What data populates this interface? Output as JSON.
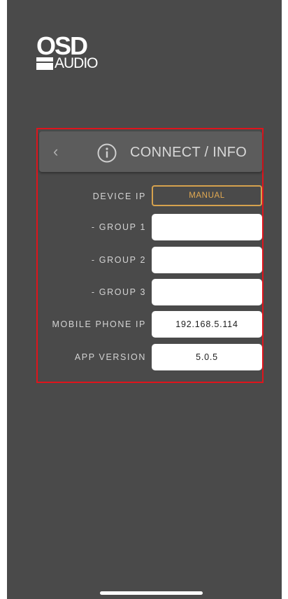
{
  "logo": {
    "line1": "OSD",
    "line2": "AUDIO"
  },
  "header": {
    "back_icon": "‹",
    "title": "CONNECT / INFO"
  },
  "rows": [
    {
      "label": "DEVICE IP",
      "button_label": "MANUAL"
    },
    {
      "label": "- GROUP 1",
      "value": ""
    },
    {
      "label": "- GROUP 2",
      "value": ""
    },
    {
      "label": "- GROUP 3",
      "value": ""
    },
    {
      "label": "MOBILE PHONE IP",
      "value": "192.168.5.114"
    },
    {
      "label": "APP VERSION",
      "value": "5.0.5"
    }
  ],
  "colors": {
    "background": "#4a4a4a",
    "header_bar": "#5c5c5c",
    "highlight": "#e0141c",
    "accent": "#d6a24e"
  },
  "icons": {
    "back": "chevron-left-icon",
    "info": "info-circle-icon"
  }
}
